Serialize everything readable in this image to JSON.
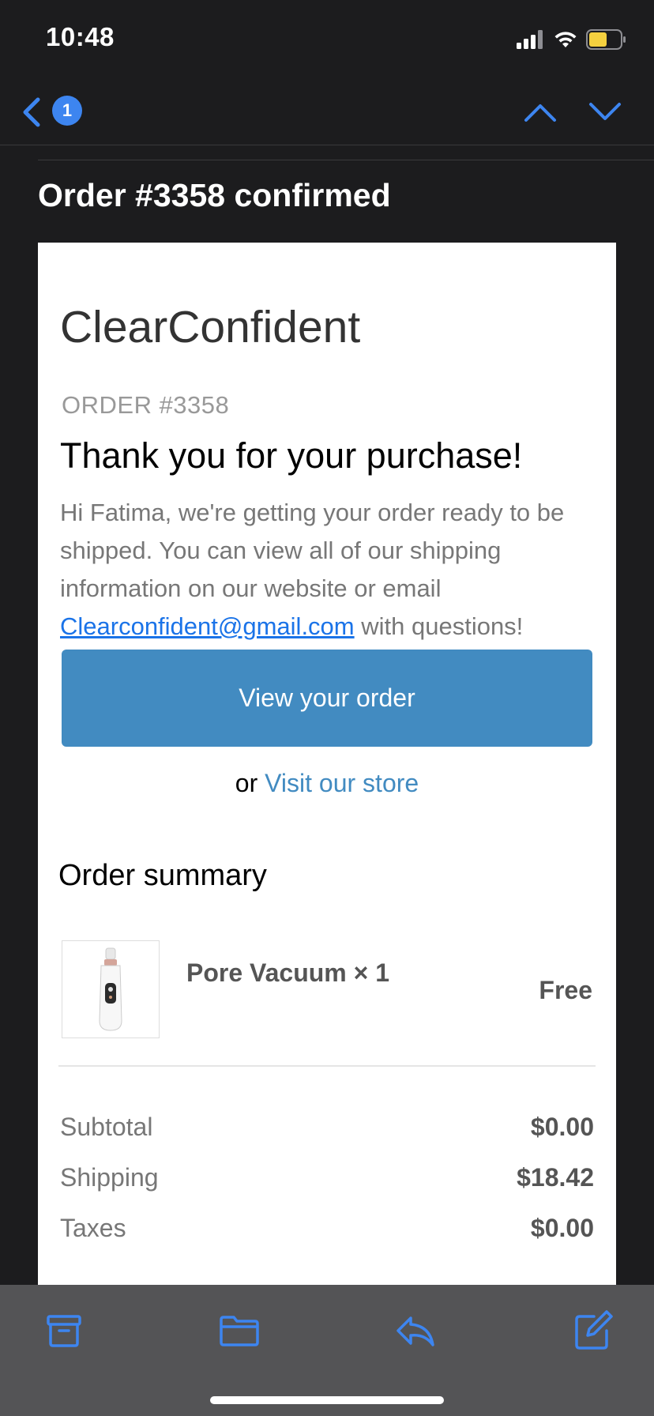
{
  "status_bar": {
    "time": "10:48",
    "icons": [
      "signal-icon",
      "wifi-icon",
      "battery-icon"
    ],
    "battery_color": "#f4d03f"
  },
  "nav": {
    "unread_count": "1",
    "icons": [
      "chevron-left-icon",
      "chevron-up-icon",
      "chevron-down-icon"
    ],
    "accent_color": "#3d85f0"
  },
  "email": {
    "subject": "Order #3358 confirmed",
    "shop_name": "ClearConfident",
    "order_label": "ORDER #3358",
    "heading": "Thank you for your purchase!",
    "intro_before": "Hi Fatima, we're getting your order ready to be shipped. You can view all of our shipping information on our website or email ",
    "intro_email": "Clearconfident@gmail.com",
    "intro_after": " with questions!",
    "view_order_label": "View your order",
    "or_text": "or ",
    "visit_store_label": "Visit our store",
    "button_color": "#428bc1"
  },
  "summary": {
    "title": "Order summary",
    "items": [
      {
        "name": "Pore Vacuum × 1",
        "price": "Free"
      }
    ],
    "totals": [
      {
        "label": "Subtotal",
        "value": "$0.00"
      },
      {
        "label": "Shipping",
        "value": "$18.42"
      },
      {
        "label": "Taxes",
        "value": "$0.00"
      }
    ]
  },
  "toolbar": {
    "icons": [
      "archive-icon",
      "folder-icon",
      "reply-icon",
      "compose-icon"
    ]
  }
}
